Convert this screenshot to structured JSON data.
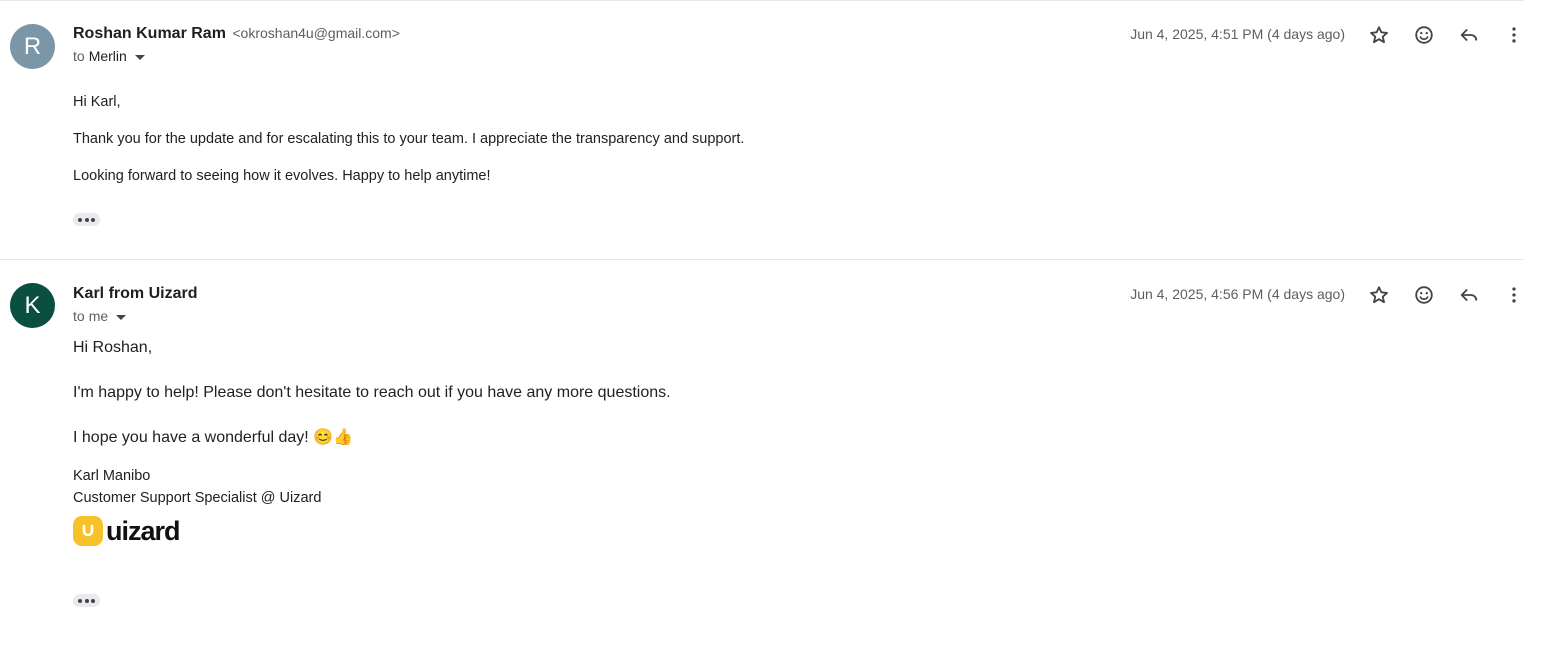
{
  "messages": [
    {
      "avatar_letter": "R",
      "avatar_color": "#7b96a6",
      "sender_name": "Roshan Kumar Ram",
      "sender_email": "<okroshan4u@gmail.com>",
      "to_label": "to",
      "recipient": "Merlin",
      "date": "Jun 4, 2025, 4:51 PM (4 days ago)",
      "body": [
        "Hi Karl,",
        "Thank you for the update and for escalating this to your team. I appreciate the transparency and support.",
        "Looking forward to seeing how it evolves. Happy to help anytime!"
      ]
    },
    {
      "avatar_letter": "K",
      "avatar_color": "#0b4f43",
      "sender_name": "Karl from Uizard",
      "to_label": "to",
      "recipient": "me",
      "date": "Jun 4, 2025, 4:56 PM (4 days ago)",
      "body": [
        "Hi Roshan,",
        "I'm happy to help! Please don't hesitate to reach out if you have any more questions.",
        "I hope you have a wonderful day! 😊👍"
      ],
      "signature_name": "Karl Manibo",
      "signature_title": "Customer Support Specialist @ Uizard",
      "logo_text": "uizard",
      "logo_color": "#f7c12a"
    }
  ],
  "icons": {
    "star": "star-icon",
    "emoji": "add-reaction-icon",
    "reply": "reply-icon",
    "more": "more-vert-icon",
    "trimmed": "show-trimmed-content-icon"
  }
}
